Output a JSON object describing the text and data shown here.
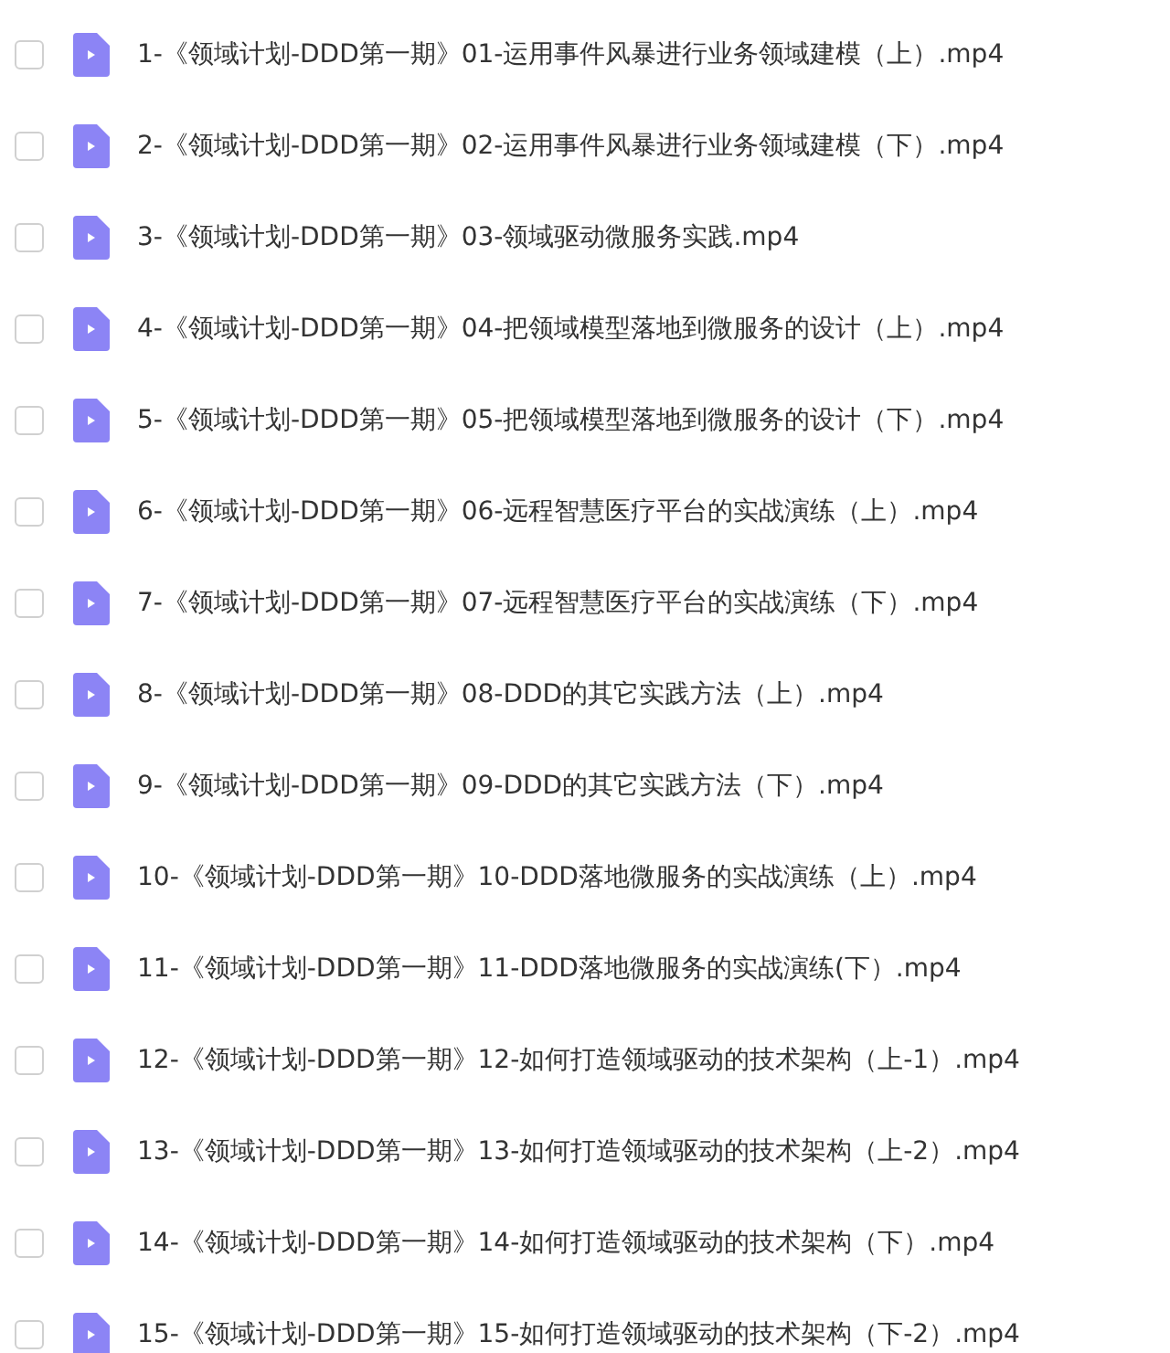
{
  "files": [
    {
      "name": "1-《领域计划-DDD第一期》01-运用事件风暴进行业务领域建模（上）.mp4",
      "checked": false
    },
    {
      "name": "2-《领域计划-DDD第一期》02-运用事件风暴进行业务领域建模（下）.mp4",
      "checked": false
    },
    {
      "name": "3-《领域计划-DDD第一期》03-领域驱动微服务实践.mp4",
      "checked": false
    },
    {
      "name": "4-《领域计划-DDD第一期》04-把领域模型落地到微服务的设计（上）.mp4",
      "checked": false
    },
    {
      "name": "5-《领域计划-DDD第一期》05-把领域模型落地到微服务的设计（下）.mp4",
      "checked": false
    },
    {
      "name": "6-《领域计划-DDD第一期》06-远程智慧医疗平台的实战演练（上）.mp4",
      "checked": false
    },
    {
      "name": "7-《领域计划-DDD第一期》07-远程智慧医疗平台的实战演练（下）.mp4",
      "checked": false
    },
    {
      "name": "8-《领域计划-DDD第一期》08-DDD的其它实践方法（上）.mp4",
      "checked": false
    },
    {
      "name": "9-《领域计划-DDD第一期》09-DDD的其它实践方法（下）.mp4",
      "checked": false
    },
    {
      "name": "10-《领域计划-DDD第一期》10-DDD落地微服务的实战演练（上）.mp4",
      "checked": false
    },
    {
      "name": "11-《领域计划-DDD第一期》11-DDD落地微服务的实战演练(下）.mp4",
      "checked": false
    },
    {
      "name": "12-《领域计划-DDD第一期》12-如何打造领域驱动的技术架构（上-1）.mp4",
      "checked": false
    },
    {
      "name": "13-《领域计划-DDD第一期》13-如何打造领域驱动的技术架构（上-2）.mp4",
      "checked": false
    },
    {
      "name": "14-《领域计划-DDD第一期》14-如何打造领域驱动的技术架构（下）.mp4",
      "checked": false
    },
    {
      "name": "15-《领域计划-DDD第一期》15-如何打造领域驱动的技术架构（下-2）.mp4",
      "checked": false
    }
  ]
}
